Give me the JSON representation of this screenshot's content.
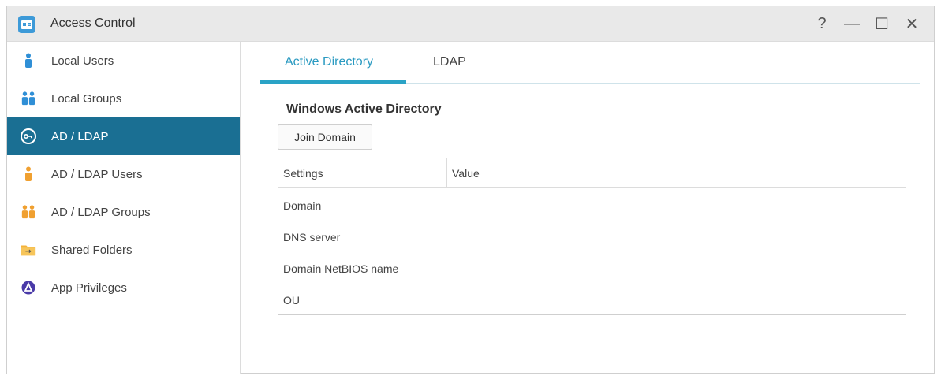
{
  "window": {
    "title": "Access Control",
    "controls": {
      "help": "?",
      "minimize": "—",
      "maximize": "☐",
      "close": "✕"
    }
  },
  "sidebar": {
    "items": [
      {
        "label": "Local Users",
        "icon": "user-icon",
        "active": false
      },
      {
        "label": "Local Groups",
        "icon": "group-icon",
        "active": false
      },
      {
        "label": "AD / LDAP",
        "icon": "key-icon",
        "active": true
      },
      {
        "label": "AD / LDAP Users",
        "icon": "user-icon",
        "active": false
      },
      {
        "label": "AD / LDAP Groups",
        "icon": "group-icon",
        "active": false
      },
      {
        "label": "Shared Folders",
        "icon": "folder-icon",
        "active": false
      },
      {
        "label": "App Privileges",
        "icon": "app-icon",
        "active": false
      }
    ]
  },
  "main": {
    "tabs": [
      {
        "label": "Active Directory",
        "active": true
      },
      {
        "label": "LDAP",
        "active": false
      }
    ],
    "section_title": "Windows Active Directory",
    "join_button": "Join Domain",
    "table": {
      "headers": [
        "Settings",
        "Value"
      ],
      "rows": [
        {
          "setting": "Domain",
          "value": ""
        },
        {
          "setting": "DNS server",
          "value": ""
        },
        {
          "setting": "Domain NetBIOS name",
          "value": ""
        },
        {
          "setting": "OU",
          "value": ""
        }
      ]
    }
  },
  "colors": {
    "accent": "#2aa3c6",
    "sidebar_active": "#1a6f93",
    "user_blue": "#2f8fd6",
    "user_orange": "#f0a030"
  }
}
